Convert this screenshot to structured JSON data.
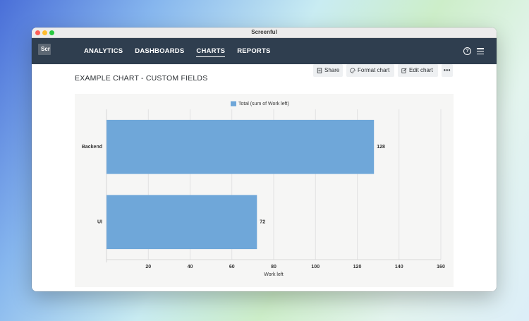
{
  "window": {
    "title": "Screenful"
  },
  "app": {
    "logo_text": "Scr",
    "nav": [
      {
        "label": "ANALYTICS",
        "active": false
      },
      {
        "label": "DASHBOARDS",
        "active": false
      },
      {
        "label": "CHARTS",
        "active": true
      },
      {
        "label": "REPORTS",
        "active": false
      }
    ],
    "help_icon": "help-circle-icon",
    "menu_icon": "hamburger-menu-icon"
  },
  "page": {
    "title": "EXAMPLE CHART - CUSTOM FIELDS",
    "actions": {
      "share": "Share",
      "format": "Format chart",
      "edit": "Edit chart",
      "more": "•••"
    }
  },
  "colors": {
    "nav_bg": "#2f3e4f",
    "bar": "#6fa7d9",
    "panel_bg": "#f6f6f5"
  },
  "chart_data": {
    "type": "bar",
    "orientation": "horizontal",
    "categories": [
      "Backend",
      "UI"
    ],
    "series": [
      {
        "name": "Total (sum of Work left)",
        "values": [
          128,
          72
        ]
      }
    ],
    "xlabel": "Work left",
    "ylabel": "",
    "xlim": [
      0,
      160
    ],
    "xticks": [
      20,
      40,
      60,
      80,
      100,
      120,
      140,
      160
    ],
    "grid": true,
    "legend": "top-center",
    "data_labels": true
  }
}
